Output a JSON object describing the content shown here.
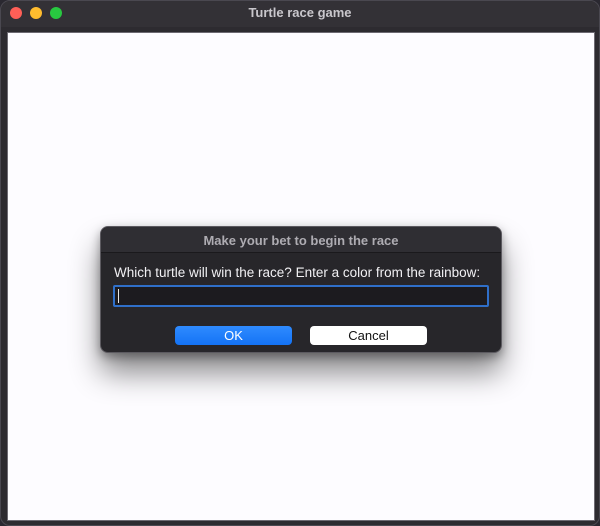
{
  "window": {
    "title": "Turtle race game",
    "controls": [
      "close",
      "minimize",
      "maximize"
    ]
  },
  "dialog": {
    "title": "Make your bet to begin the race",
    "prompt": "Which turtle will win the race? Enter a color from the rainbow:",
    "input_value": "",
    "ok_label": "OK",
    "cancel_label": "Cancel"
  },
  "colors": {
    "ok_button": "#1a7bff",
    "input_border": "#2f6fc9",
    "canvas_background": "#fdfcff",
    "dialog_background": "#27262a"
  }
}
